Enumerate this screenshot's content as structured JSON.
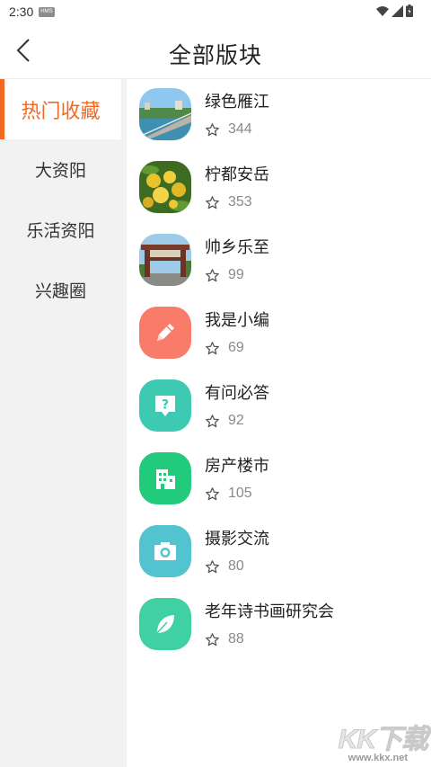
{
  "status_bar": {
    "time": "2:30",
    "badge": "HMS"
  },
  "header": {
    "title": "全部版块"
  },
  "sidebar": {
    "items": [
      {
        "label": "热门收藏",
        "active": true
      },
      {
        "label": "大资阳",
        "active": false
      },
      {
        "label": "乐活资阳",
        "active": false
      },
      {
        "label": "兴趣圈",
        "active": false
      }
    ]
  },
  "forums": [
    {
      "name": "绿色雁江",
      "count": "344",
      "icon": "bridge-photo"
    },
    {
      "name": "柠都安岳",
      "count": "353",
      "icon": "lemon-photo"
    },
    {
      "name": "帅乡乐至",
      "count": "99",
      "icon": "gate-photo"
    },
    {
      "name": "我是小编",
      "count": "69",
      "icon": "pencil-icon",
      "color": "#f97c6b"
    },
    {
      "name": "有问必答",
      "count": "92",
      "icon": "question-bubble-icon",
      "color": "#3ec9b3"
    },
    {
      "name": "房产楼市",
      "count": "105",
      "icon": "building-icon",
      "color": "#22cb7c"
    },
    {
      "name": "摄影交流",
      "count": "80",
      "icon": "camera-icon",
      "color": "#52c3cf"
    },
    {
      "name": "老年诗书画研究会",
      "count": "88",
      "icon": "leaf-icon",
      "color": "#3fd0a4"
    }
  ],
  "colors": {
    "accent": "#f06a26",
    "sidebar_bg": "#f2f2f2"
  },
  "watermark": {
    "logo": "KK下载",
    "url": "www.kkx.net"
  }
}
